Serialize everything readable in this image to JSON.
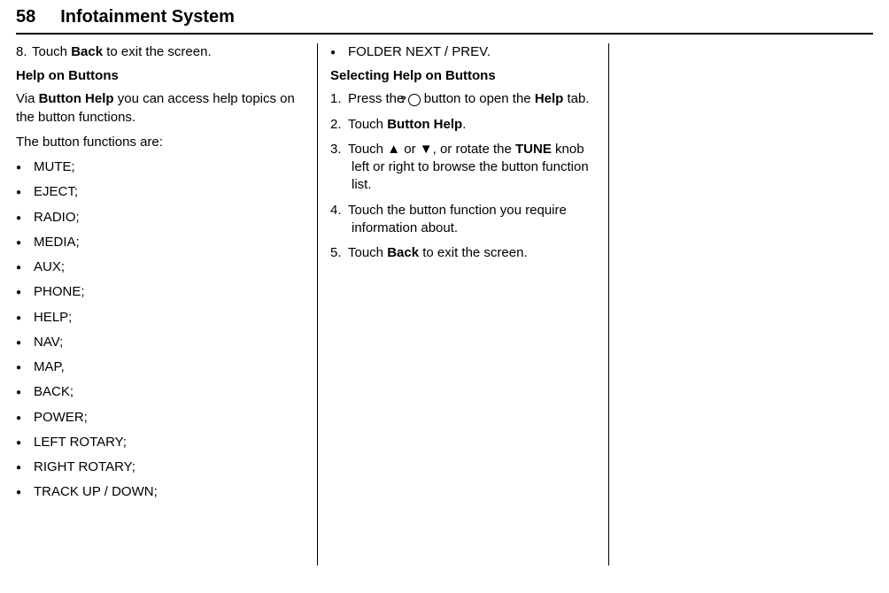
{
  "header": {
    "page_number": "58",
    "title": "Infotainment System"
  },
  "col1": {
    "step8_num": "8.",
    "step8_prefix": "Touch ",
    "step8_bold": "Back",
    "step8_suffix": " to exit the screen.",
    "heading1": "Help on Buttons",
    "para1_prefix": "Via ",
    "para1_bold": "Button Help",
    "para1_suffix": " you can access help topics on the button functions.",
    "para2": "The button functions are:",
    "functions": [
      "MUTE;",
      "EJECT;",
      "RADIO;",
      "MEDIA;",
      "AUX;",
      "PHONE;",
      "HELP;",
      "NAV;",
      "MAP,",
      "BACK;",
      "POWER;",
      "LEFT ROTARY;",
      "RIGHT ROTARY;",
      "TRACK UP / DOWN;"
    ]
  },
  "col2": {
    "top_bullet": "FOLDER NEXT / PREV.",
    "heading2": "Selecting Help on Buttons",
    "step1_num": "1.",
    "step1_a": "Press the ",
    "step1_icon": "?",
    "step1_b": " button to open the ",
    "step1_bold": "Help",
    "step1_c": " tab.",
    "step2_num": "2.",
    "step2_a": "Touch ",
    "step2_bold": "Button Help",
    "step2_b": ".",
    "step3_num": "3.",
    "step3_a": "Touch ",
    "step3_sym1": "▲",
    "step3_b": " or ",
    "step3_sym2": "▼",
    "step3_c": ", or rotate the ",
    "step3_bold": "TUNE",
    "step3_d": " knob left or right to browse the button function list.",
    "step4_num": "4.",
    "step4": "Touch the button function you require information about.",
    "step5_num": "5.",
    "step5_a": "Touch ",
    "step5_bold": "Back",
    "step5_b": " to exit the screen."
  }
}
